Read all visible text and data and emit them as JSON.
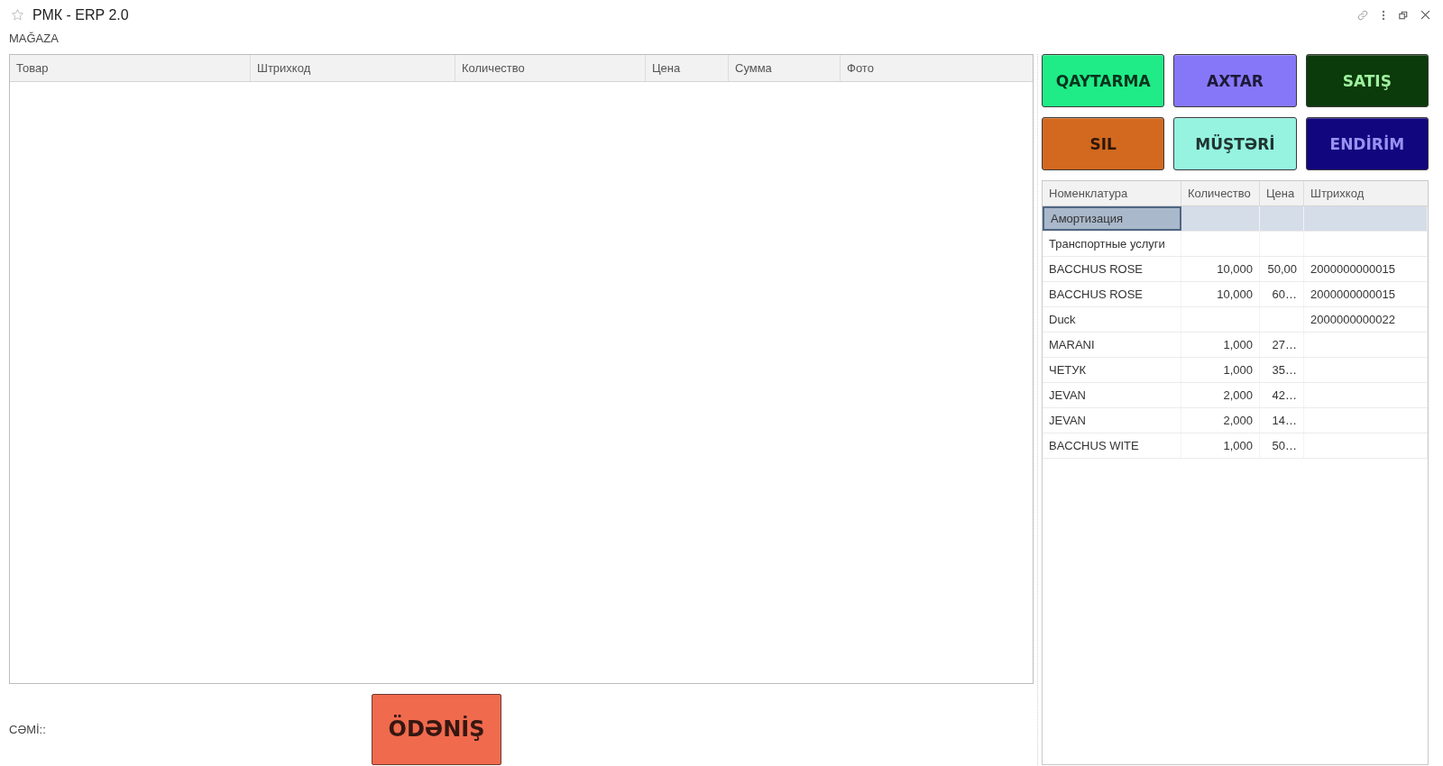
{
  "window": {
    "title": "РМК - ERP 2.0"
  },
  "section_label": "MAĞAZA",
  "cart_table": {
    "columns": [
      "Товар",
      "Штрихкод",
      "Количество",
      "Цена",
      "Сумма",
      "Фото"
    ]
  },
  "action_buttons": [
    {
      "label": "QAYTARMA",
      "color": "#1fec86"
    },
    {
      "label": "AXTAR",
      "color": "#8677f8"
    },
    {
      "label": "SATIŞ",
      "color": "#0b3a0b"
    },
    {
      "label": "SIL",
      "color": "#d2691f"
    },
    {
      "label": "MÜŞTƏRİ",
      "color": "#95f3e0"
    },
    {
      "label": "ENDİRİM",
      "color": "#12067f"
    }
  ],
  "product_table": {
    "columns": [
      "Номенклатура",
      "Количество",
      "Цена",
      "Штрихкод"
    ],
    "rows": [
      {
        "name": "Амортизация",
        "selected": true
      },
      {
        "name": "Транспортные услуги",
        "selected": false
      },
      {
        "name": "BACCHUS ROSE",
        "quantity": "10,000",
        "price": "50,00",
        "barcode": "2000000000015",
        "selected": false
      },
      {
        "name": "BACCHUS ROSE",
        "quantity": "10,000",
        "price": "60…",
        "barcode": "2000000000015",
        "selected": false
      },
      {
        "name": "Duck",
        "barcode": "2000000000022",
        "selected": false
      },
      {
        "name": "MARANI",
        "quantity": "1,000",
        "price": "27…",
        "selected": false
      },
      {
        "name": "ЧЕТУК",
        "quantity": "1,000",
        "price": "35…",
        "selected": false
      },
      {
        "name": "JEVAN",
        "quantity": "2,000",
        "price": "42…",
        "selected": false
      },
      {
        "name": "JEVAN",
        "quantity": "2,000",
        "price": "14…",
        "selected": false
      },
      {
        "name": "BACCHUS WITE",
        "quantity": "1,000",
        "price": "50…",
        "selected": false
      }
    ]
  },
  "total": {
    "label": "CƏMİ::"
  },
  "pay_button": {
    "label": "ÖDƏNİŞ",
    "color": "#f06a4e"
  }
}
